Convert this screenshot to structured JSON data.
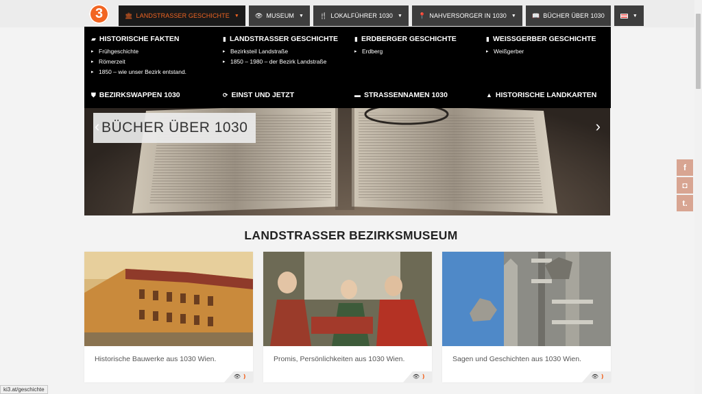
{
  "logo": {
    "text": "3"
  },
  "nav": [
    {
      "icon": "building-icon",
      "glyph": "🏛",
      "label": "Landstrasser Geschichte",
      "caret": "▼",
      "active": true
    },
    {
      "icon": "eye-icon",
      "glyph": "👁",
      "label": "Museum",
      "caret": "▼"
    },
    {
      "icon": "cutlery-icon",
      "glyph": "🍴",
      "label": "Lokalführer 1030",
      "caret": "▼"
    },
    {
      "icon": "map-marker-icon",
      "glyph": "📍",
      "label": "Nahversorger in 1030",
      "caret": "▼"
    },
    {
      "icon": "book-icon",
      "glyph": "📖",
      "label": "Bücher über 1030"
    }
  ],
  "mega_menu": {
    "columns": [
      {
        "heading": "Historische Fakten",
        "items": [
          "Frühgeschichte",
          "Römerzeit",
          "1850 – wie unser Bezirk entstand."
        ]
      },
      {
        "heading": "Landstrasser Geschichte",
        "items": [
          "Bezirksteil Landstraße",
          "1850 – 1980 – der Bezirk Landstraße"
        ]
      },
      {
        "heading": "Erdberger Geschichte",
        "items": [
          "Erdberg"
        ]
      },
      {
        "heading": "Weissgerber Geschichte",
        "items": [
          "Weißgerber"
        ]
      }
    ],
    "bottom_links": [
      {
        "label": "Bezirkswappen 1030"
      },
      {
        "label": "Einst und Jetzt"
      },
      {
        "label": "Strassennamen 1030"
      },
      {
        "label": "Historische Landkarten"
      }
    ]
  },
  "hero": {
    "title": "BÜCHER ÜBER 1030",
    "prev": "‹",
    "next": "›"
  },
  "section": {
    "title": "LANDSTRASSER BEZIRKSMUSEUM"
  },
  "cards": [
    {
      "caption": "Historische Bauwerke aus 1030 Wien."
    },
    {
      "caption": "Promis, Persönlichkeiten aus 1030 Wien."
    },
    {
      "caption": "Sagen und Geschichten aus 1030 Wien."
    }
  ],
  "social": [
    {
      "icon": "facebook-icon",
      "glyph": "f"
    },
    {
      "icon": "instagram-icon",
      "glyph": "◘"
    },
    {
      "icon": "tumblr-icon",
      "glyph": "t."
    }
  ],
  "status_bar": {
    "url": "ki3.at/geschichte"
  },
  "colors": {
    "accent": "#f26522",
    "nav_bg": "#3d3d3d",
    "mega_bg": "#000000",
    "social_bg": "#d8a592"
  }
}
